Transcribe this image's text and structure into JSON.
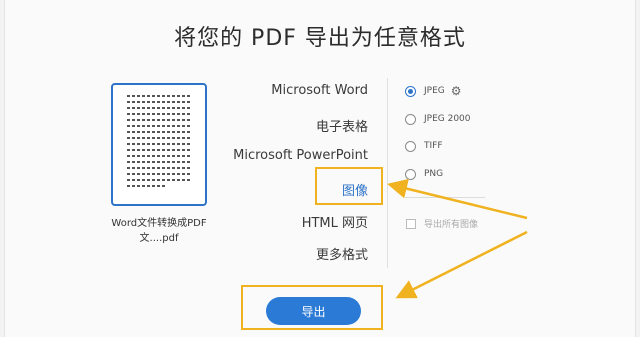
{
  "title": "将您的 PDF 导出为任意格式",
  "file": {
    "name": "Word文件转换成PDF文....pdf"
  },
  "formats": [
    "Microsoft Word",
    "电子表格",
    "Microsoft PowerPoint",
    "图像",
    "HTML 网页",
    "更多格式"
  ],
  "selected_format": "图像",
  "image_options": [
    {
      "label": "JPEG",
      "selected": true,
      "has_settings": true
    },
    {
      "label": "JPEG 2000",
      "selected": false
    },
    {
      "label": "TIFF",
      "selected": false
    },
    {
      "label": "PNG",
      "selected": false
    }
  ],
  "export_all_images": {
    "label": "导出所有图像",
    "checked": false,
    "enabled": false
  },
  "export_button": "导出",
  "colors": {
    "accent": "#2a7ad6",
    "highlight": "#f0b21e"
  },
  "icons": {
    "settings": "gear-icon"
  }
}
